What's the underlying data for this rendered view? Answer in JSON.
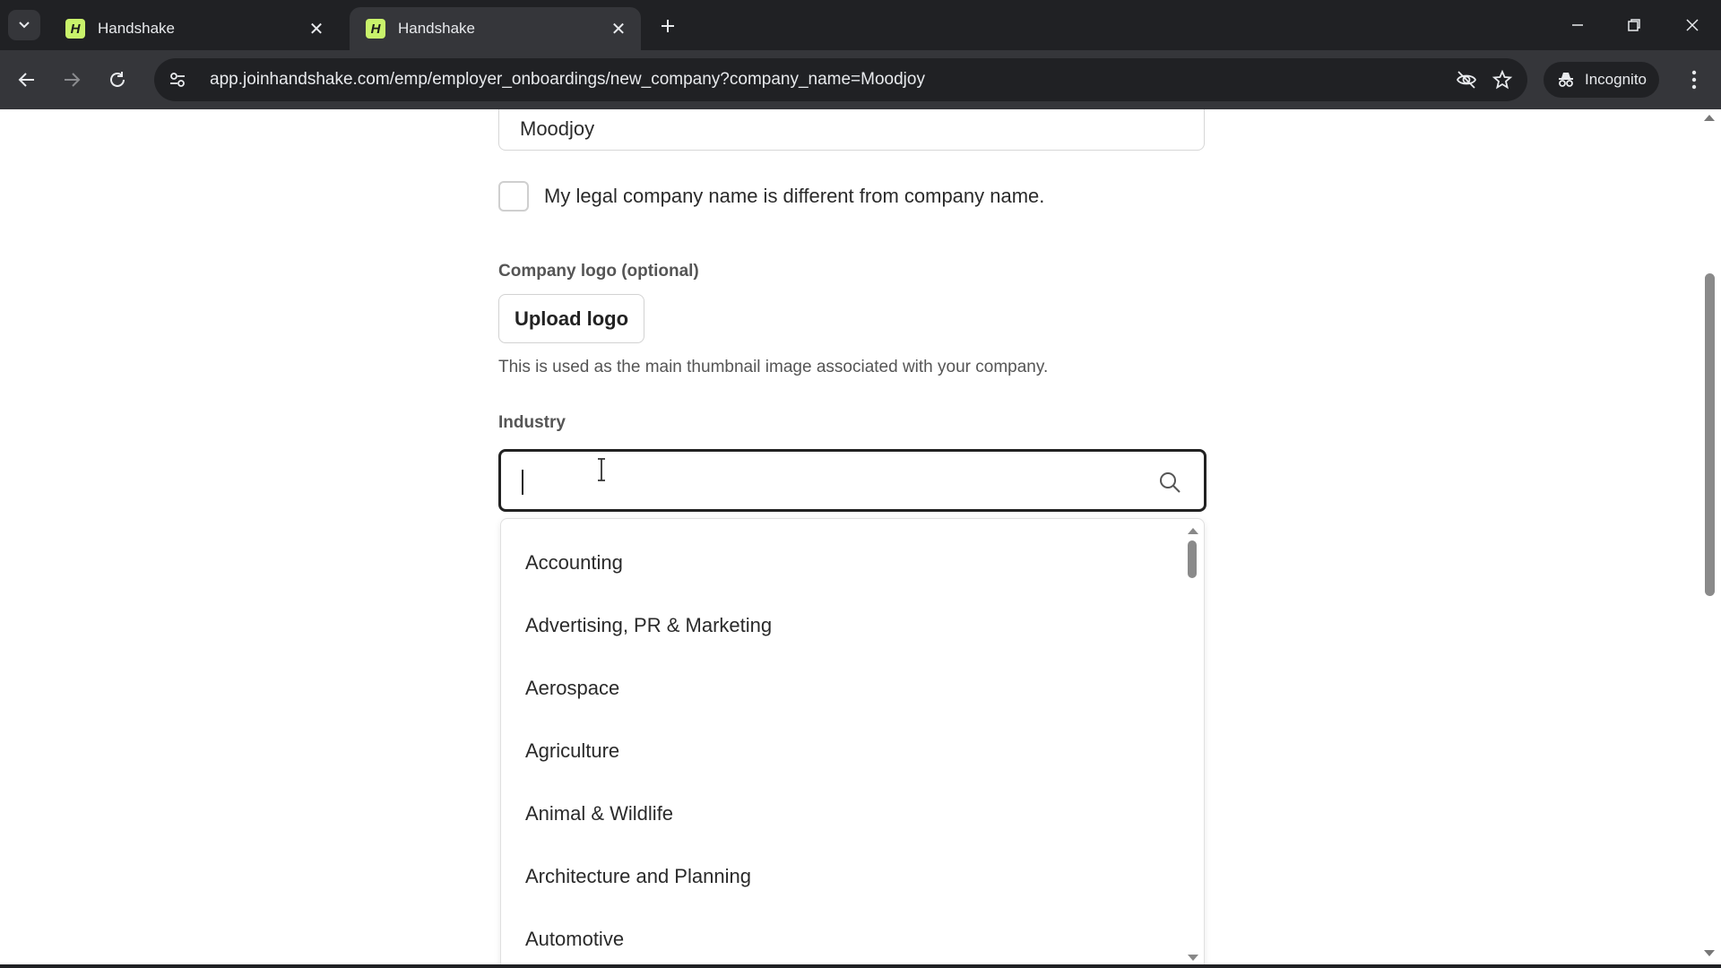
{
  "browser": {
    "tabs": [
      {
        "title": "Handshake",
        "favicon": "H",
        "active": false
      },
      {
        "title": "Handshake",
        "favicon": "H",
        "active": true
      }
    ],
    "url": "app.joinhandshake.com/emp/employer_onboardings/new_company?company_name=Moodjoy",
    "incognito_label": "Incognito"
  },
  "form": {
    "company_name_value": "Moodjoy",
    "legal_name_checkbox_label": "My legal company name is different from company name.",
    "legal_name_checked": false,
    "logo_label": "Company logo (optional)",
    "upload_button_label": "Upload logo",
    "logo_help": "This is used as the main thumbnail image associated with your company.",
    "industry_label": "Industry",
    "industry_value": "",
    "industry_options": [
      "Accounting",
      "Advertising, PR & Marketing",
      "Aerospace",
      "Agriculture",
      "Animal & Wildlife",
      "Architecture and Planning",
      "Automotive"
    ]
  },
  "icons": {
    "tab_menu": "chevron-down-icon",
    "tab_close": "close-icon",
    "new_tab": "plus-icon",
    "back": "arrow-left-icon",
    "forward": "arrow-right-icon",
    "reload": "reload-icon",
    "site_info": "tune-icon",
    "eye_off": "eye-off-icon",
    "bookmark": "star-icon",
    "incognito": "incognito-icon",
    "menu": "kebab-icon",
    "search": "search-icon"
  },
  "colors": {
    "chrome_dark": "#202124",
    "chrome_tab": "#35363a",
    "favicon": "#c9f26b",
    "input_focus_border": "#222222"
  }
}
